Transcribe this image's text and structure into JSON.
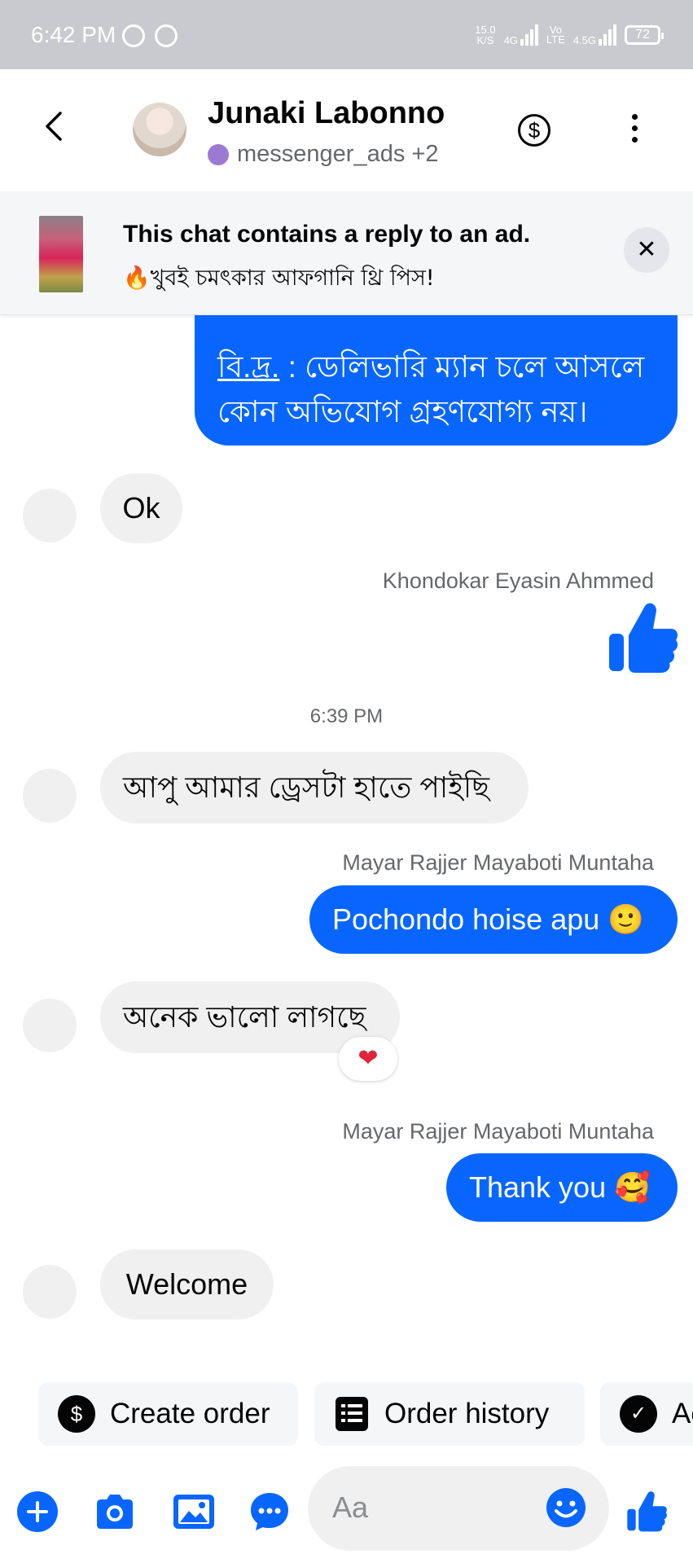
{
  "status_bar": {
    "time": "6:42 PM",
    "speed_value": "15.0",
    "speed_unit": "K/S",
    "net1": "4G",
    "net2_top": "Vo",
    "net2_bottom": "LTE",
    "net3": "4.5G",
    "battery": "72"
  },
  "header": {
    "contact_name": "Junaki Labonno",
    "subtitle": "messenger_ads +2",
    "dollar_symbol": "$"
  },
  "ad_banner": {
    "title": "This chat contains a reply to an ad.",
    "subtitle": "🔥খুবই চমৎকার আফগানি থ্রি পিস!",
    "close": "✕"
  },
  "messages": {
    "m1_abbr": "বি.দ্র.",
    "m1_rest": " : ডেলিভারি ম্যান চলে আসলে",
    "m1_line2": "কোন অভিযোগ গ্রহণযোগ্য নয়।",
    "m2": "Ok",
    "sender1": "Khondokar Eyasin Ahmmed",
    "time1": "6:39 PM",
    "m3": "আপু আমার ড্রেসটা হাতে পাইছি",
    "sender2": "Mayar Rajjer Mayaboti Muntaha",
    "m4": "Pochondo hoise apu 🙂",
    "m5": "অনেক ভালো লাগছে",
    "m5_reaction": "❤",
    "sender3": "Mayar Rajjer Mayaboti Muntaha",
    "m6": "Thank you 🥰",
    "m7": "Welcome"
  },
  "quick_actions": {
    "create_order": "Create order",
    "create_order_icon": "$",
    "order_history": "Order history",
    "third_partial": "Ac"
  },
  "composer": {
    "placeholder": "Aa"
  },
  "colors": {
    "accent": "#0866ff",
    "incoming_bubble": "#f0f0f0",
    "status_bar": "#c9cacf"
  }
}
